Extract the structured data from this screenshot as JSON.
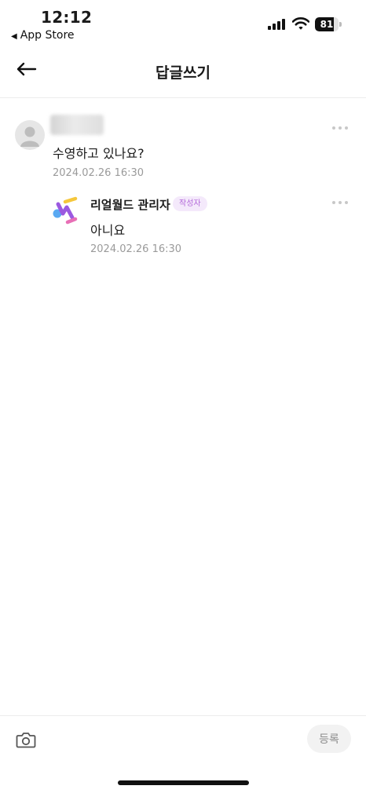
{
  "status_bar": {
    "time": "12:12",
    "back_app": "App Store",
    "battery_level": "81",
    "battery_fraction": 0.81
  },
  "header": {
    "title": "답글쓰기",
    "back_icon": "arrow-left-icon"
  },
  "comment": {
    "text": "수영하고 있나요?",
    "date": "2024.02.26 16:30"
  },
  "reply": {
    "author": "리얼월드 관리자",
    "badge": "작성자",
    "text": "아니요",
    "date": "2024.02.26 16:30"
  },
  "footer": {
    "camera_icon": "camera-icon",
    "submit_label": "등록"
  },
  "colors": {
    "badge_bg": "#f4e9fb",
    "badge_text": "#b36ad9",
    "muted_text": "#9a9a9a"
  }
}
